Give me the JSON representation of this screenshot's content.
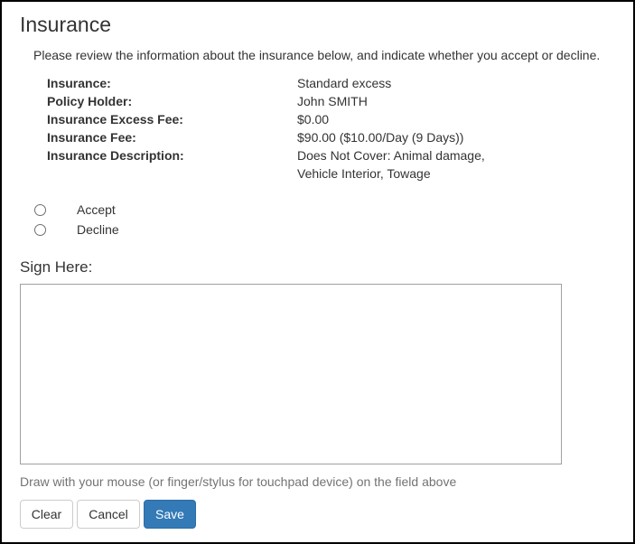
{
  "page": {
    "title": "Insurance",
    "intro": "Please review the information about the insurance below, and indicate whether you accept or decline."
  },
  "details": [
    {
      "label": "Insurance:",
      "value": "Standard excess"
    },
    {
      "label": "Policy Holder:",
      "value": "John SMITH"
    },
    {
      "label": "Insurance Excess Fee:",
      "value": "$0.00"
    },
    {
      "label": "Insurance Fee:",
      "value": "$90.00 ($10.00/Day (9 Days))"
    },
    {
      "label": "Insurance Description:",
      "value": "Does Not Cover: Animal damage, Vehicle Interior, Towage"
    }
  ],
  "choices": {
    "accept_label": "Accept",
    "decline_label": "Decline",
    "selected": null
  },
  "signature": {
    "title": "Sign Here:",
    "help_text": "Draw with your mouse (or finger/stylus for touchpad device) on the field above"
  },
  "buttons": {
    "clear_label": "Clear",
    "cancel_label": "Cancel",
    "save_label": "Save"
  },
  "colors": {
    "primary": "#337ab7",
    "text": "#333333",
    "muted": "#737373"
  }
}
